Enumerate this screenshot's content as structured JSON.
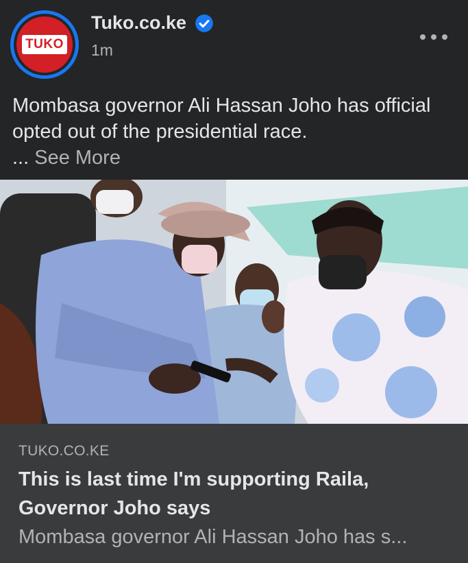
{
  "post": {
    "page_name": "Tuko.co.ke",
    "avatar_text": "TUKO",
    "time": "1m",
    "text": "Mombasa governor Ali Hassan Joho has official opted out of the presidential race.",
    "see_more_prefix": "... ",
    "see_more_label": "See More"
  },
  "link_preview": {
    "domain": "TUKO.CO.KE",
    "title": "This is last time I'm supporting Raila, Governor Joho says",
    "description": "Mombasa governor Ali Hassan Joho has s..."
  },
  "icons": {
    "verified": "verified-badge-icon",
    "more": "more-options-icon"
  },
  "colors": {
    "background": "#242526",
    "link_box": "#3a3b3c",
    "accent": "#1877f2",
    "brand_red": "#d31f26"
  }
}
